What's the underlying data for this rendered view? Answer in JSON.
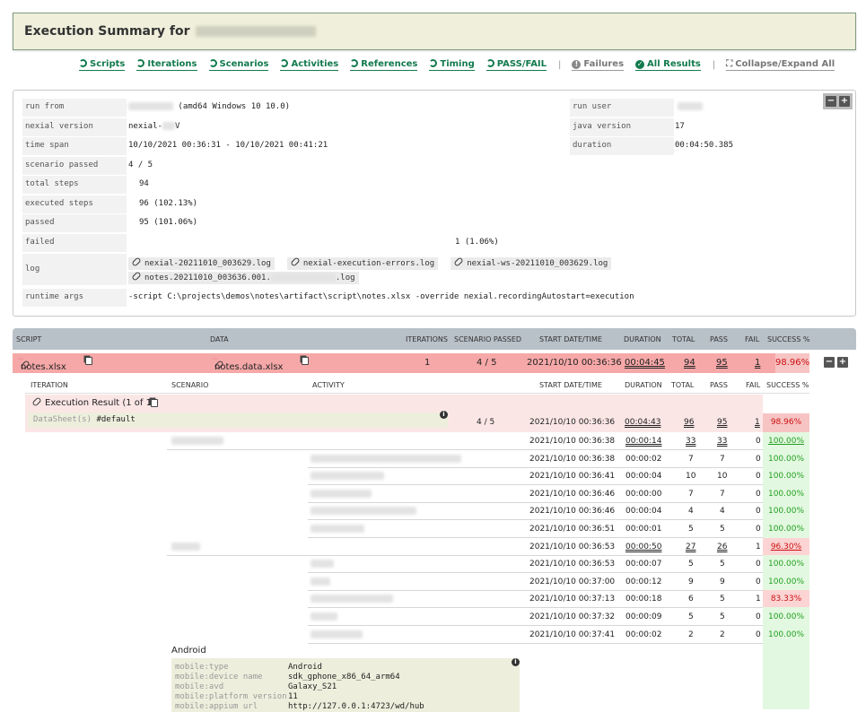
{
  "header": {
    "title": "Execution Summary for"
  },
  "nav": {
    "scripts": "Scripts",
    "iterations": "Iterations",
    "scenarios": "Scenarios",
    "activities": "Activities",
    "references": "References",
    "timing": "Timing",
    "passfail": "PASS/FAIL",
    "failures": "Failures",
    "all_results": "All Results",
    "collapse": "Collapse/Expand All"
  },
  "summary": {
    "run_from_label": "run from",
    "run_from_value": "(amd64 Windows 10 10.0)",
    "run_user_label": "run user",
    "nexial_version_label": "nexial version",
    "nexial_version_value_prefix": "nexial-",
    "nexial_version_value_suffix": "V",
    "java_version_label": "java version",
    "java_version_value": "17",
    "time_span_label": "time span",
    "time_span_value": "10/10/2021 00:36:31 - 10/10/2021 00:41:21",
    "duration_label": "duration",
    "duration_value": "00:04:50.385",
    "scenario_passed_label": "scenario passed",
    "scenario_passed_value": "4 / 5",
    "total_steps_label": "total steps",
    "total_steps_value": "94",
    "executed_steps_label": "executed steps",
    "executed_steps_value": "96 (102.13%)",
    "passed_label": "passed",
    "passed_value": "95 (101.06%)",
    "failed_label": "failed",
    "failed_value": "1 (1.06%)",
    "log_label": "log",
    "logs": [
      "nexial-20211010_003629.log",
      "nexial-execution-errors.log",
      "nexial-ws-20211010_003629.log"
    ],
    "log4_prefix": "notes.20211010_003636.001.",
    "log4_suffix": ".log",
    "runtime_args_label": "runtime args",
    "runtime_args_value": "-script C:\\projects\\demos\\notes\\artifact\\script\\notes.xlsx -override nexial.recordingAutostart=execution"
  },
  "results_header": {
    "script": "SCRIPT",
    "data": "DATA",
    "iterations": "ITERATIONS",
    "scenario_passed": "SCENARIO PASSED",
    "start": "START DATE/TIME",
    "duration": "DURATION",
    "total": "TOTAL",
    "pass": "PASS",
    "fail": "FAIL",
    "success": "SUCCESS %"
  },
  "script_row": {
    "script": "notes.xlsx",
    "data": "notes.data.xlsx",
    "iterations": "1",
    "scenario_passed": "4 / 5",
    "start": "2021/10/10 00:36:36",
    "duration": "00:04:45",
    "total": "94",
    "pass": "95",
    "fail": "1",
    "success": "98.96%"
  },
  "iteration_header": {
    "iteration": "ITERATION",
    "scenario": "SCENARIO",
    "activity": "ACTIVITY",
    "start": "START DATE/TIME",
    "duration": "DURATION",
    "total": "TOTAL",
    "pass": "PASS",
    "fail": "FAIL",
    "success": "SUCCESS %"
  },
  "execution_result": {
    "title": "Execution Result (1 of 1)",
    "datasheet_label": "DataSheet(s)",
    "datasheet_value": "#default",
    "scenario_passed": "4 / 5",
    "start": "2021/10/10 00:36:36",
    "duration": "00:04:43",
    "total": "96",
    "pass": "95",
    "fail": "1",
    "success": "98.96%"
  },
  "rows": [
    {
      "start": "2021/10/10 00:36:38",
      "duration": "00:00:14",
      "total": "33",
      "pass": "33",
      "fail": "0",
      "success": "100.00%",
      "level": "scenario",
      "status": "pass"
    },
    {
      "start": "2021/10/10 00:36:38",
      "duration": "00:00:02",
      "total": "7",
      "pass": "7",
      "fail": "0",
      "success": "100.00%",
      "level": "activity",
      "status": "pass"
    },
    {
      "start": "2021/10/10 00:36:41",
      "duration": "00:00:04",
      "total": "10",
      "pass": "10",
      "fail": "0",
      "success": "100.00%",
      "level": "activity",
      "status": "pass"
    },
    {
      "start": "2021/10/10 00:36:46",
      "duration": "00:00:00",
      "total": "7",
      "pass": "7",
      "fail": "0",
      "success": "100.00%",
      "level": "activity",
      "status": "pass"
    },
    {
      "start": "2021/10/10 00:36:46",
      "duration": "00:00:04",
      "total": "4",
      "pass": "4",
      "fail": "0",
      "success": "100.00%",
      "level": "activity",
      "status": "pass"
    },
    {
      "start": "2021/10/10 00:36:51",
      "duration": "00:00:01",
      "total": "5",
      "pass": "5",
      "fail": "0",
      "success": "100.00%",
      "level": "activity",
      "status": "pass"
    },
    {
      "start": "2021/10/10 00:36:53",
      "duration": "00:00:50",
      "total": "27",
      "pass": "26",
      "fail": "1",
      "success": "96.30%",
      "level": "scenario",
      "status": "fail"
    },
    {
      "start": "2021/10/10 00:36:53",
      "duration": "00:00:07",
      "total": "5",
      "pass": "5",
      "fail": "0",
      "success": "100.00%",
      "level": "activity",
      "status": "pass"
    },
    {
      "start": "2021/10/10 00:37:00",
      "duration": "00:00:12",
      "total": "9",
      "pass": "9",
      "fail": "0",
      "success": "100.00%",
      "level": "activity",
      "status": "pass"
    },
    {
      "start": "2021/10/10 00:37:13",
      "duration": "00:00:18",
      "total": "6",
      "pass": "5",
      "fail": "1",
      "success": "83.33%",
      "level": "activity",
      "status": "fail"
    },
    {
      "start": "2021/10/10 00:37:32",
      "duration": "00:00:09",
      "total": "5",
      "pass": "5",
      "fail": "0",
      "success": "100.00%",
      "level": "activity",
      "status": "pass"
    },
    {
      "start": "2021/10/10 00:37:41",
      "duration": "00:00:02",
      "total": "2",
      "pass": "2",
      "fail": "0",
      "success": "100.00%",
      "level": "activity",
      "status": "pass"
    }
  ],
  "android": {
    "title": "Android",
    "props": [
      {
        "k": "mobile:type",
        "v": "Android"
      },
      {
        "k": "mobile:device name",
        "v": "sdk_gphone_x86_64_arm64"
      },
      {
        "k": "mobile:avd",
        "v": "Galaxy_S21"
      },
      {
        "k": "mobile:platform version",
        "v": "11"
      },
      {
        "k": "mobile:appium url",
        "v": "http://127.0.0.1:4723/wd/hub"
      }
    ]
  },
  "colors": {
    "pass_bg": "#e3f8e0",
    "fail_bg": "#f6a8a8",
    "pass_text": "#22a022",
    "fail_text": "#cc1111",
    "link": "#127a4d"
  }
}
